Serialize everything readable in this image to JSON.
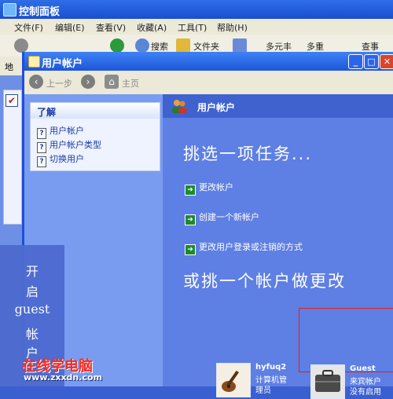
{
  "bg_window": {
    "title": "控制面板",
    "menu": [
      "文件(F)",
      "编辑(E)",
      "查看(V)",
      "收藏(A)",
      "工具(T)",
      "帮助(H)"
    ],
    "toolbar": {
      "search": "搜索",
      "folders": "文件夹",
      "address_label": "地"
    },
    "right_labels": [
      "多元丰",
      "多重",
      "查事"
    ]
  },
  "win": {
    "title": "用户帐户",
    "nav": {
      "back": "上一步",
      "home": "主页"
    },
    "learn": {
      "heading": "了解",
      "items": [
        "用户帐户",
        "用户帐户类型",
        "切换用户"
      ]
    },
    "band_title": "用户帐户",
    "heading1": "挑选一项任务...",
    "tasks": [
      "更改帐户",
      "创建一个新帐户",
      "更改用户登录或注销的方式"
    ],
    "heading2": "或挑一个帐户做更改",
    "accounts": [
      {
        "name": "hyfuq2",
        "line2": "计算机管",
        "line3": "理员"
      },
      {
        "name": "Guest",
        "line2": "来宾帐户",
        "line3": "没有启用"
      }
    ]
  },
  "overlay": {
    "lines": [
      "开",
      "启",
      "guest",
      "帐",
      "户"
    ]
  },
  "watermark": {
    "site": "在线学电脑",
    "url": "www.zxxdn.com"
  }
}
